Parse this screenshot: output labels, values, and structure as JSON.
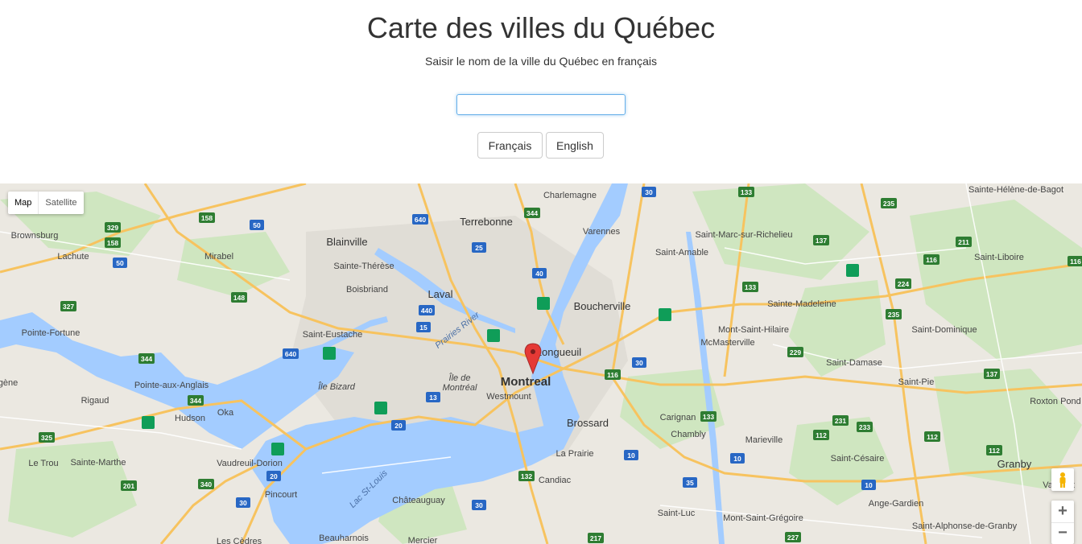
{
  "header": {
    "title": "Carte des villes du Québec",
    "subtitle": "Saisir le nom de la ville du Québec en français",
    "input_value": "",
    "btn_fr": "Français",
    "btn_en": "English"
  },
  "map": {
    "type_map": "Map",
    "type_satellite": "Satellite",
    "zoom_in": "+",
    "zoom_out": "−",
    "colors": {
      "water": "#a3ccff",
      "land": "#e8e6df",
      "park": "#c5e3b5",
      "highway": "#f7c35f",
      "road": "#ffffff",
      "shield_green": "#2e7d32",
      "shield_blue": "#2867c4",
      "marker": "#e53935"
    },
    "cities": [
      "Terrebonne",
      "Charlemagne",
      "Blainville",
      "Sainte-Thérèse",
      "Boisbriand",
      "Laval",
      "Varennes",
      "Saint-Amable",
      "Boucherville",
      "Saint-Marc-sur-Richelieu",
      "Sainte-Hélène-de-Bagot",
      "Brownsburg",
      "Lachute",
      "Mirabel",
      "Saint-Liboire",
      "Sainte-Madeleine",
      "Mont-Saint-Hilaire",
      "McMasterville",
      "Saint-Dominique",
      "Pointe-Fortune",
      "Saint-Eustache",
      "Longueuil",
      "Montreal",
      "Westmount",
      "Île de Montréal",
      "Île Bizard",
      "Pointe-aux-Anglais",
      "Rigaud",
      "Hudson",
      "Oka",
      "Saint-Damase",
      "Saint-Pie",
      "Roxton Pond",
      "Brossard",
      "Carignan",
      "Chambly",
      "Marieville",
      "Vaudreuil-Dorion",
      "Pincourt",
      "La Prairie",
      "Candiac",
      "Châteauguay",
      "Saint-Césaire",
      "Granby",
      "Le Trou",
      "Sainte-Marthe",
      "Saint-Luc",
      "Mont-Saint-Grégoire",
      "Ange-Gardien",
      "Saint-Alphonse-de-Granby",
      "Beauharnois",
      "Mercier",
      "Les Cèdres",
      "Valcourt",
      "gène"
    ],
    "water_labels": [
      "Prairies River",
      "Lac St-Louis"
    ],
    "shields": [
      "640",
      "344",
      "30",
      "133",
      "235",
      "329",
      "158",
      "50",
      "25",
      "211",
      "116",
      "40",
      "224",
      "148",
      "327",
      "133",
      "235",
      "440",
      "15",
      "640",
      "344",
      "116",
      "229",
      "30",
      "137",
      "13",
      "20",
      "344",
      "325",
      "340",
      "201",
      "20",
      "30",
      "132",
      "30",
      "10",
      "35",
      "10",
      "227",
      "217",
      "112",
      "231",
      "233",
      "137",
      "133",
      "112",
      "112",
      "10",
      "116"
    ]
  }
}
